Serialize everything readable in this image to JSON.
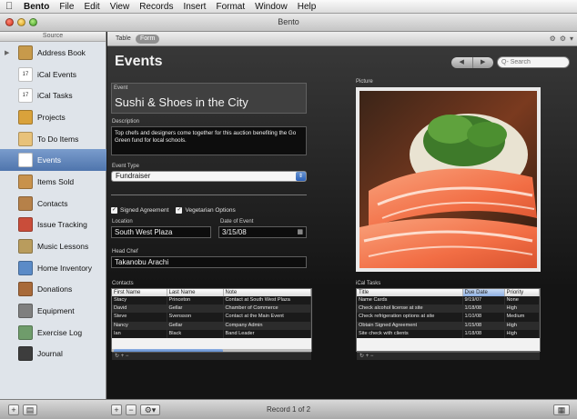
{
  "menubar": {
    "app": "Bento",
    "items": [
      "File",
      "Edit",
      "View",
      "Records",
      "Insert",
      "Format",
      "Window",
      "Help"
    ]
  },
  "window": {
    "title": "Bento"
  },
  "sidebar": {
    "header": "Source",
    "items": [
      {
        "label": "Address Book",
        "icon": "address-book-icon",
        "color": "#c79a4b"
      },
      {
        "label": "iCal Events",
        "icon": "ical-events-icon",
        "color": "#cf3b2c",
        "badge": "17"
      },
      {
        "label": "iCal Tasks",
        "icon": "ical-tasks-icon",
        "color": "#cf3b2c",
        "badge": "17"
      },
      {
        "label": "Projects",
        "icon": "projects-icon",
        "color": "#d9a23b"
      },
      {
        "label": "To Do Items",
        "icon": "todo-icon",
        "color": "#e8c27a"
      },
      {
        "label": "Events",
        "icon": "events-icon",
        "color": "#ffffff"
      },
      {
        "label": "Items Sold",
        "icon": "items-sold-icon",
        "color": "#c8924c"
      },
      {
        "label": "Contacts",
        "icon": "contacts-icon",
        "color": "#b68149"
      },
      {
        "label": "Issue Tracking",
        "icon": "issue-tracking-icon",
        "color": "#c94d3a"
      },
      {
        "label": "Music Lessons",
        "icon": "music-lessons-icon",
        "color": "#b99c5d"
      },
      {
        "label": "Home Inventory",
        "icon": "home-inventory-icon",
        "color": "#5b8bc7"
      },
      {
        "label": "Donations",
        "icon": "donations-icon",
        "color": "#a86a3a"
      },
      {
        "label": "Equipment",
        "icon": "equipment-icon",
        "color": "#7f7f7f"
      },
      {
        "label": "Exercise Log",
        "icon": "exercise-log-icon",
        "color": "#6f9c6b"
      },
      {
        "label": "Journal",
        "icon": "journal-icon",
        "color": "#3d3d3d"
      }
    ]
  },
  "toolbar": {
    "tab_table": "Table",
    "tab_form": "Form"
  },
  "page": {
    "title": "Events"
  },
  "search": {
    "placeholder": "Q- Search"
  },
  "form": {
    "event_label": "Event",
    "event_value": "Sushi & Shoes in the City",
    "description_label": "Description",
    "description_value": "Top chefs and designers come together for this auction benefiting the Go Green fund for local schools.",
    "event_type_label": "Event Type",
    "event_type_value": "Fundraiser",
    "signed_agreement": "Signed Agreement",
    "vegetarian_options": "Vegetarian Options",
    "location_label": "Location",
    "location_value": "South West Plaza",
    "date_label": "Date of Event",
    "date_value": "3/15/08",
    "head_chef_label": "Head Chef",
    "head_chef_value": "Takanobu Arachi",
    "picture_label": "Picture"
  },
  "contacts": {
    "label": "Contacts",
    "columns": [
      "First Name",
      "Last Name",
      "Note"
    ],
    "rows": [
      [
        "Stacy",
        "Princeton",
        "Contact at South West Plaza"
      ],
      [
        "David",
        "Gellar",
        "Chamber of Commerce"
      ],
      [
        "Steve",
        "Svensson",
        "Contact at the Main Event"
      ],
      [
        "Nancy",
        "Gellar",
        "Company Admin"
      ],
      [
        "Ian",
        "Black",
        "Band Leader"
      ]
    ]
  },
  "tasks": {
    "label": "iCal Tasks",
    "columns": [
      "Title",
      "Due Date",
      "Priority"
    ],
    "rows": [
      [
        "Name Cards",
        "9/19/07",
        "None"
      ],
      [
        "Check alcohol license at site",
        "1/18/08",
        "High"
      ],
      [
        "Check refrigeration options at site",
        "1/10/08",
        "Medium"
      ],
      [
        "Obtain Signed Agreement",
        "1/15/08",
        "High"
      ],
      [
        "Site check with clients",
        "1/18/08",
        "High"
      ]
    ]
  },
  "footer": {
    "record_count": "Record 1 of 2"
  }
}
